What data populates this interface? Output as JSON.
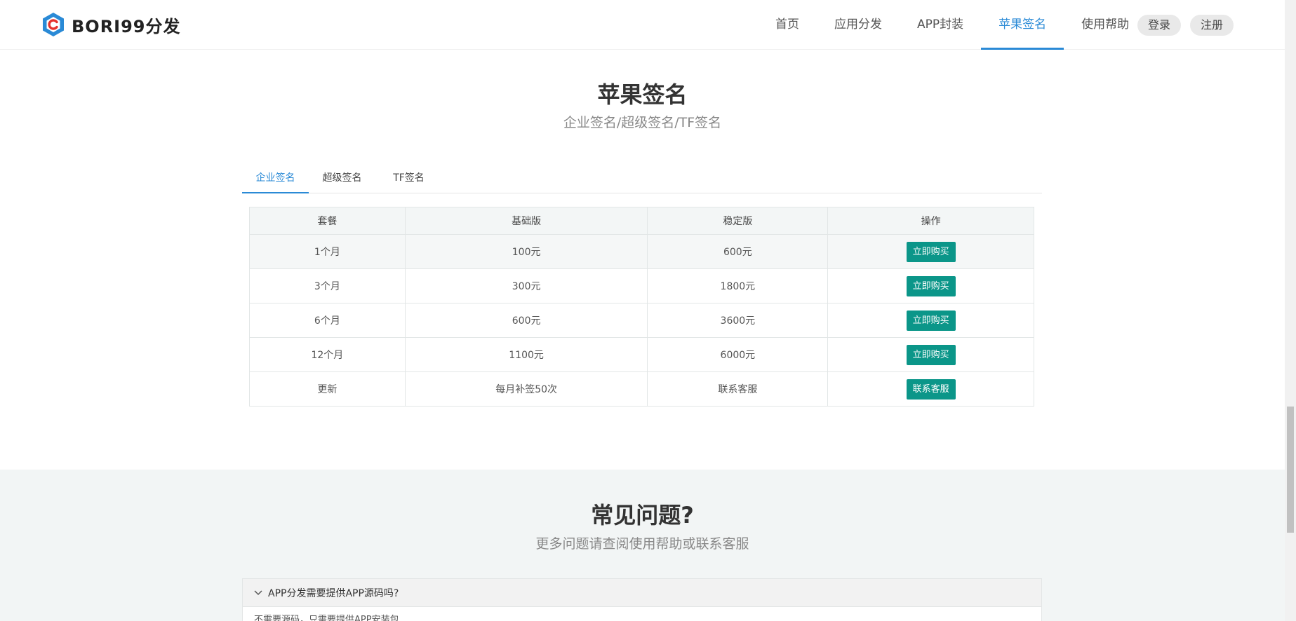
{
  "header": {
    "logo_text": "BORI99分发",
    "nav": [
      {
        "label": "首页",
        "active": false
      },
      {
        "label": "应用分发",
        "active": false
      },
      {
        "label": "APP封装",
        "active": false
      },
      {
        "label": "苹果签名",
        "active": true
      },
      {
        "label": "使用帮助",
        "active": false
      }
    ],
    "login_label": "登录",
    "register_label": "注册"
  },
  "signing": {
    "title": "苹果签名",
    "subtitle": "企业签名/超级签名/TF签名",
    "tabs": [
      {
        "label": "企业签名",
        "active": true
      },
      {
        "label": "超级签名",
        "active": false
      },
      {
        "label": "TF签名",
        "active": false
      }
    ],
    "table": {
      "headers": [
        "套餐",
        "基础版",
        "稳定版",
        "操作"
      ],
      "rows": [
        {
          "plan": "1个月",
          "basic": "100元",
          "stable": "600元",
          "action": "立即购买"
        },
        {
          "plan": "3个月",
          "basic": "300元",
          "stable": "1800元",
          "action": "立即购买"
        },
        {
          "plan": "6个月",
          "basic": "600元",
          "stable": "3600元",
          "action": "立即购买"
        },
        {
          "plan": "12个月",
          "basic": "1100元",
          "stable": "6000元",
          "action": "立即购买"
        },
        {
          "plan": "更新",
          "basic": "每月补签50次",
          "stable": "联系客服",
          "action": "联系客服"
        }
      ]
    }
  },
  "faq": {
    "title": "常见问题?",
    "subtitle": "更多问题请查阅使用帮助或联系客服",
    "items": [
      {
        "question": "APP分发需要提供APP源码吗?",
        "answer": "不需要源码，只需要提供APP安装包"
      }
    ]
  },
  "colors": {
    "accent": "#2a8ad6",
    "button": "#0b9689",
    "faq_bg": "#f2f5f5"
  },
  "icons": [
    "logo-icon",
    "chevron-down-icon"
  ]
}
